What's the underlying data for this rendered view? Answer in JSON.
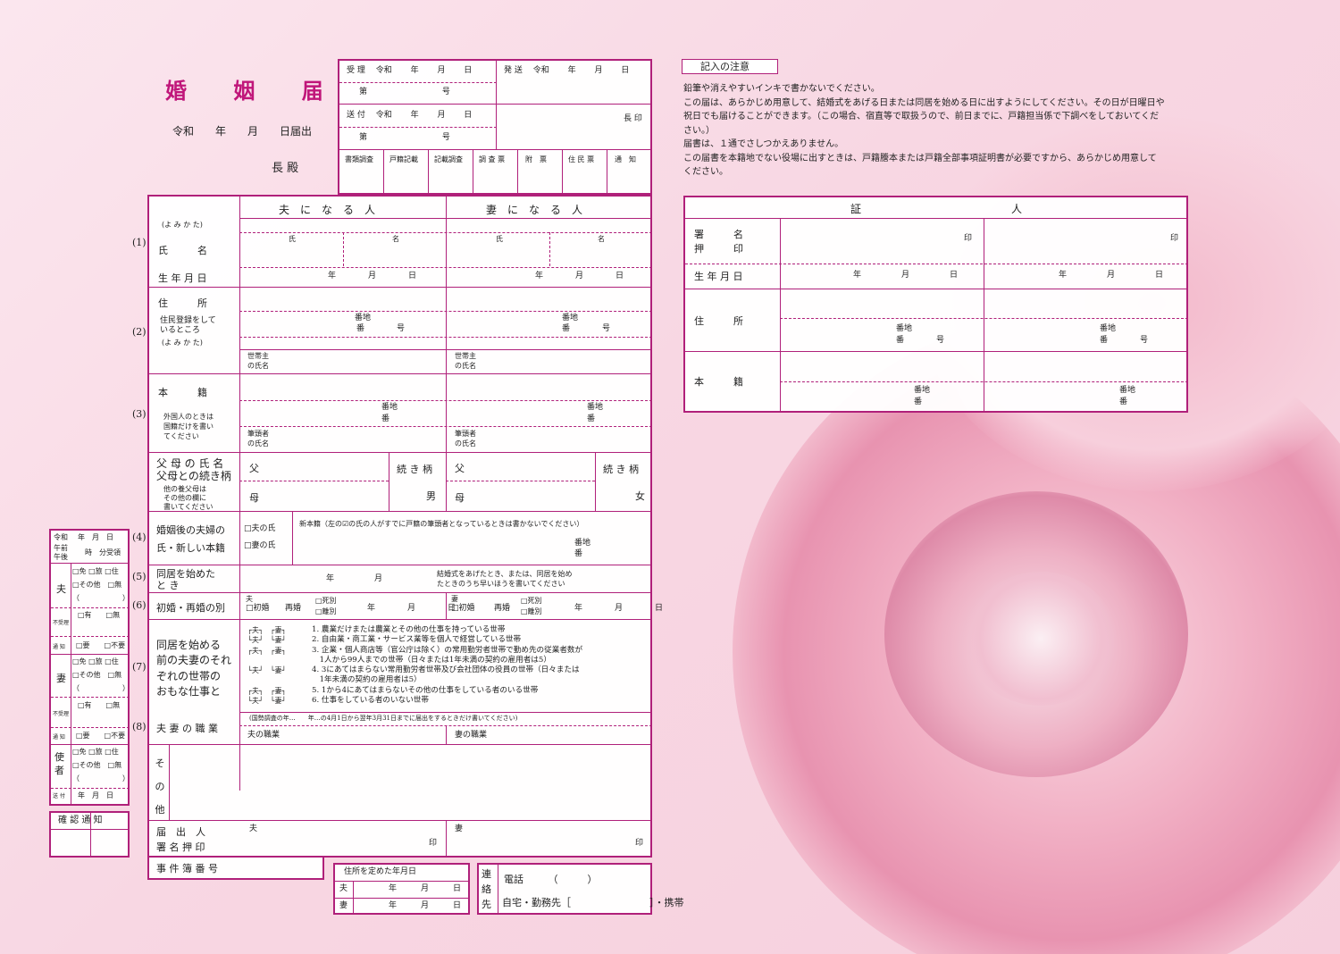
{
  "header": {
    "title": "婚 姻 届",
    "date_line": "令和　　年　　月　　日届出",
    "recipient": "長 殿"
  },
  "reception": {
    "received": "受 理　 令和　　 年　　 月　　 日",
    "received_no": "第　　　　　　　　　 号",
    "sent": "発 送　 令和　　 年　　 月　　 日",
    "delivered": "送 付　 令和　　 年　　 月　　 日",
    "delivered_no": "第　　　　　　　　　 号",
    "chief_seal": "長 印",
    "checks": [
      "書類調査",
      "戸籍記載",
      "記載調査",
      "調 査 票",
      "附　票",
      "住 民 票",
      "通　知"
    ]
  },
  "notes": {
    "heading": "記入の注意",
    "lines": [
      "鉛筆や消えやすいインキで書かないでください。",
      "この届は、あらかじめ用意して、結婚式をあげる日または同居を始める日に出すようにしてください。その日が日曜日や",
      "祝日でも届けることができます。（この場合、宿直等で取扱うので、前日までに、戸籍担当係で下調べをしておいてくだ",
      "さい。）",
      "届書は、１通でさしつかえありません。",
      "この届書を本籍地でない役場に出すときは、戸籍謄本または戸籍全部事項証明書が必要ですから、あらかじめ用意して",
      "ください。"
    ]
  },
  "form": {
    "husband_header": "夫　に　な　る　人",
    "wife_header": "妻　に　な　る　人",
    "yomi": "(よ み か た)",
    "name_label": "氏　　　名",
    "birth_label": "生 年 月 日",
    "sei": "氏",
    "mei": "名",
    "ymd": "年　　　　月　　　　日",
    "address_label": "住　　　所",
    "address_sub1": "住民登録をして",
    "address_sub2": "いるところ",
    "address_yomi": "(よ み か た)",
    "banchi": "番地",
    "ban_go": "番　　　　号",
    "householder1": "世帯主",
    "householder2": "の氏名",
    "honseki_label": "本　　　籍",
    "foreign1": "外国人のときは",
    "foreign2": "国籍だけを書い",
    "foreign3": "てください",
    "ban": "番",
    "head1": "筆頭者",
    "head2": "の氏名",
    "parents_label1": "父 母 の 氏 名",
    "parents_label2": "父母との続き柄",
    "parents_sub1": "他の養父母は",
    "parents_sub2": "その他の欄に",
    "parents_sub3": "書いてください",
    "father": "父",
    "mother": "母",
    "relation": "続 き 柄",
    "son": "男",
    "daughter": "女",
    "surname_label1": "婚姻後の夫婦の",
    "surname_label2": "氏・新しい本籍",
    "husband_surname": "□夫の氏",
    "wife_surname": "□妻の氏",
    "new_honseki": "新本籍（左の☑の氏の人がすでに戸籍の筆頭者となっているときは書かないでください）",
    "cohab_label1": "同居を始めた",
    "cohab_label2": "と き",
    "cohab_ym": "年　　　　　月",
    "cohab_note1": "結婚式をあげたとき、または、同居を始め",
    "cohab_note2": "たときのうち早いほうを書いてください",
    "marriage_label": "初婚・再婚の別",
    "first": "□初婚",
    "second": "再婚",
    "death": "□死別",
    "divorce": "□離別",
    "work_label1": "同居を始める",
    "work_label2": "前の夫妻のそれ",
    "work_label3": "ぞれの世帯の",
    "work_label4": "おもな仕事と",
    "h": "夫",
    "w": "妻",
    "work_items": [
      "1. 農業だけまたは農業とその他の仕事を持っている世帯",
      "2. 自由業・商工業・サービス業等を個人で経営している世帯",
      "3. 企業・個人商店等（官公庁は除く）の常用勤労者世帯で勤め先の従業者数が",
      "　1人から99人までの世帯（日々または1年未満の契約の雇用者は5）",
      "4. 3にあてはまらない常用勤労者世帯及び会社団体の役員の世帯（日々または",
      "　1年未満の契約の雇用者は5）",
      "5. 1から4にあてはまらないその他の仕事をしている者のいる世帯",
      "6. 仕事をしている者のいない世帯"
    ],
    "census_note": "(国勢調査の年…　　年…の4月1日から翌年3月31日までに届出をするときだけ書いてください)",
    "occupation_label": "夫 妻 の 職 業",
    "husband_occ": "夫の職業",
    "wife_occ": "妻の職業",
    "other_label": "そ の 他",
    "sign_label1": "届　出　人",
    "sign_label2": "署 名 押 印",
    "seal": "印",
    "case_no": "事 件 簿 番 号",
    "addr_date_label": "住所を定めた年月日",
    "addr_ymd": "年　　　月　　　日",
    "contact_label": "連絡先",
    "phone": "電話　　　（　　　）",
    "home_work": "自宅・勤務先［　　　　　　　　］・携帯",
    "nums": [
      "(1)",
      "(2)",
      "(3)",
      "(4)",
      "(5)",
      "(6)",
      "(7)",
      "(8)"
    ]
  },
  "side": {
    "era": "令和",
    "ymd": "年　月　日",
    "am": "午前",
    "pm": "午後",
    "time": "時　分受領",
    "opts1": "□免 □旅 □住",
    "opts2": "□その他　□無",
    "paren": "（　　　　　　）",
    "have": "□有　　□無",
    "unused": "不受理",
    "notify": "通 知",
    "need": "□要　　□不要",
    "husband": "夫",
    "wife": "妻",
    "messenger": "使者",
    "sent": "送 付",
    "ymd_small": "年　月　日",
    "confirm": "確 認 通 知"
  },
  "witness": {
    "title": "証　　　　　　　　　　　　　　人",
    "sign_label1": "署　　　名",
    "sign_label2": "押　　　印",
    "seal": "印",
    "birth_label": "生 年 月 日",
    "ymd": "年　　　　　月　　　　　日",
    "address_label": "住　　　所",
    "banchi": "番地",
    "ban_go": "番　　　　号",
    "honseki_label": "本　　　籍",
    "ban": "番"
  },
  "colors": {
    "accent": "#b0207a",
    "title": "#c0167a",
    "rose": "#f2a5bd"
  }
}
